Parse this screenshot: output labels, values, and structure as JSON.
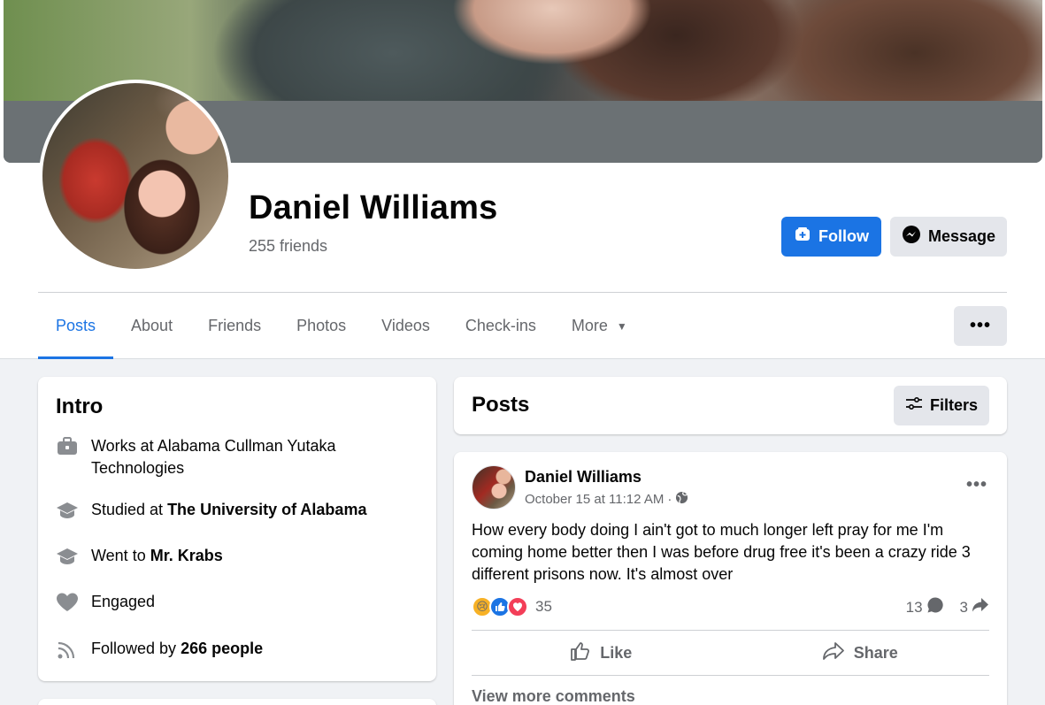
{
  "profile": {
    "name": "Daniel Williams",
    "friends": "255 friends"
  },
  "actions": {
    "follow_label": "Follow",
    "message_label": "Message"
  },
  "tabs": [
    {
      "label": "Posts"
    },
    {
      "label": "About"
    },
    {
      "label": "Friends"
    },
    {
      "label": "Photos"
    },
    {
      "label": "Videos"
    },
    {
      "label": "Check-ins"
    },
    {
      "label": "More"
    }
  ],
  "intro": {
    "title": "Intro",
    "work": {
      "text": "Works at Alabama Cullman Yutaka Technologies"
    },
    "studied": {
      "prefix": "Studied at ",
      "bold": "The University of Alabama"
    },
    "went": {
      "prefix": "Went to ",
      "bold": "Mr. Krabs"
    },
    "relationship": {
      "text": "Engaged"
    },
    "followed": {
      "prefix": "Followed by ",
      "bold": "266 people"
    }
  },
  "posts_header": {
    "title": "Posts",
    "filters_label": "Filters"
  },
  "post": {
    "author": "Daniel Williams",
    "time": "October 15 at 11:12 AM",
    "separator": "·",
    "text": "How every body doing I ain't got to much longer left pray for me I'm coming home better then I was before drug free it's been a crazy ride 3 different prisons now. It's almost over",
    "reaction_count": "35",
    "comment_count": "13",
    "share_count": "3",
    "like_label": "Like",
    "share_label": "Share",
    "view_more": "View more comments"
  },
  "colors": {
    "accent": "#1b74e4",
    "page_bg": "#f0f2f5",
    "secondary_text": "#65676b"
  }
}
